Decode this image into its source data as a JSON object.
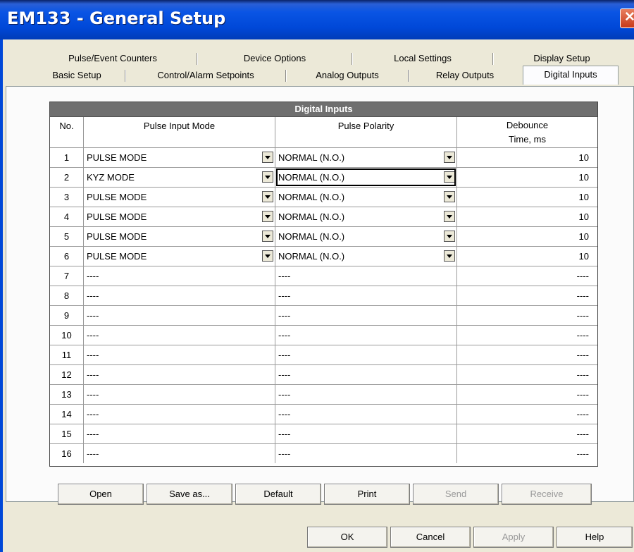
{
  "window": {
    "title": "EM133 - General Setup",
    "close_glyph": "✕"
  },
  "tabs_row1": [
    "Pulse/Event Counters",
    "Device Options",
    "Local Settings",
    "Display Setup"
  ],
  "tabs_row2": [
    "Basic Setup",
    "Control/Alarm Setpoints",
    "Analog Outputs",
    "Relay Outputs",
    "Digital Inputs"
  ],
  "active_tab": "Digital Inputs",
  "grid": {
    "title": "Digital Inputs",
    "columns": {
      "no": "No.",
      "mode": "Pulse Input Mode",
      "polarity": "Pulse Polarity",
      "debounce_line1": "Debounce",
      "debounce_line2": "Time, ms"
    },
    "rows": [
      {
        "no": "1",
        "mode": "PULSE MODE",
        "polarity": "NORMAL (N.O.)",
        "debounce": "10"
      },
      {
        "no": "2",
        "mode": "KYZ MODE",
        "polarity": "NORMAL (N.O.)",
        "debounce": "10"
      },
      {
        "no": "3",
        "mode": "PULSE MODE",
        "polarity": "NORMAL (N.O.)",
        "debounce": "10"
      },
      {
        "no": "4",
        "mode": "PULSE MODE",
        "polarity": "NORMAL (N.O.)",
        "debounce": "10"
      },
      {
        "no": "5",
        "mode": "PULSE MODE",
        "polarity": "NORMAL (N.O.)",
        "debounce": "10"
      },
      {
        "no": "6",
        "mode": "PULSE MODE",
        "polarity": "NORMAL (N.O.)",
        "debounce": "10"
      },
      {
        "no": "7",
        "mode": "----",
        "polarity": "----",
        "debounce": "----"
      },
      {
        "no": "8",
        "mode": "----",
        "polarity": "----",
        "debounce": "----"
      },
      {
        "no": "9",
        "mode": "----",
        "polarity": "----",
        "debounce": "----"
      },
      {
        "no": "10",
        "mode": "----",
        "polarity": "----",
        "debounce": "----"
      },
      {
        "no": "11",
        "mode": "----",
        "polarity": "----",
        "debounce": "----"
      },
      {
        "no": "12",
        "mode": "----",
        "polarity": "----",
        "debounce": "----"
      },
      {
        "no": "13",
        "mode": "----",
        "polarity": "----",
        "debounce": "----"
      },
      {
        "no": "14",
        "mode": "----",
        "polarity": "----",
        "debounce": "----"
      },
      {
        "no": "15",
        "mode": "----",
        "polarity": "----",
        "debounce": "----"
      },
      {
        "no": "16",
        "mode": "----",
        "polarity": "----",
        "debounce": "----"
      }
    ]
  },
  "panel_buttons": {
    "open": "Open",
    "save_as": "Save as...",
    "default": "Default",
    "print": "Print",
    "send": "Send",
    "receive": "Receive"
  },
  "dialog_buttons": {
    "ok": "OK",
    "cancel": "Cancel",
    "apply": "Apply",
    "help": "Help"
  },
  "icons": {
    "close": "close-icon",
    "dropdown": "chevron-down-icon"
  }
}
